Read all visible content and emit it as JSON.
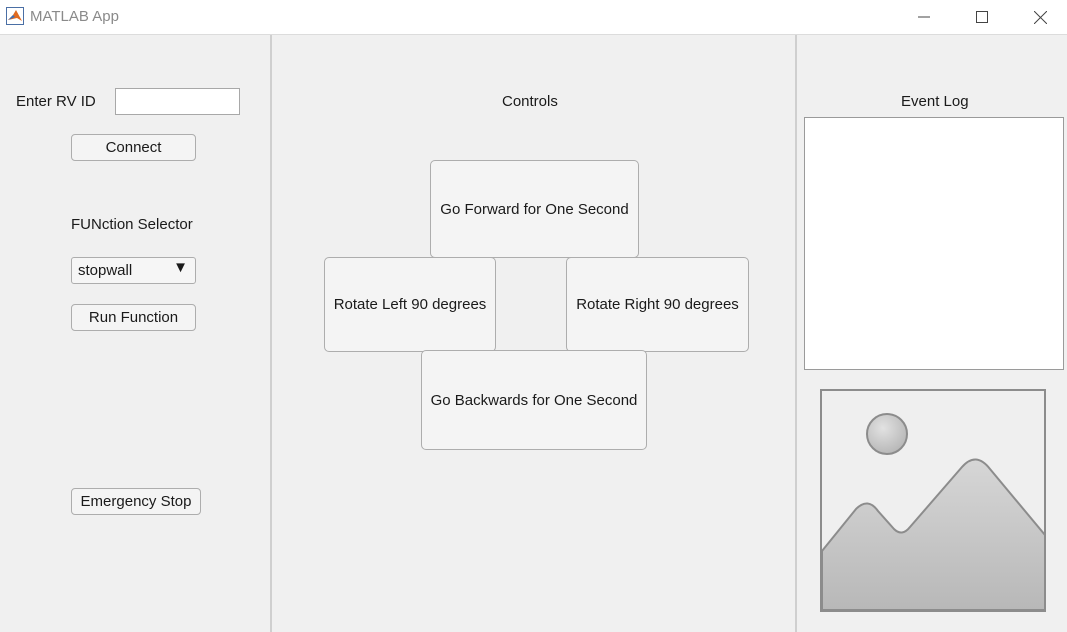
{
  "window": {
    "title": "MATLAB App",
    "icon": "matlab-icon",
    "controls": {
      "minimize": "minimize-icon",
      "maximize": "maximize-icon",
      "close": "close-icon"
    }
  },
  "left_panel": {
    "rv_id_label": "Enter RV ID",
    "rv_id_value": "",
    "connect_label": "Connect",
    "function_selector_label": "FUNction Selector",
    "function_selected": "stopwall",
    "run_function_label": "Run Function",
    "emergency_stop_label": "Emergency Stop"
  },
  "center_panel": {
    "title": "Controls",
    "forward_label": "Go Forward for One Second",
    "rotate_left_label": "Rotate Left 90 degrees",
    "rotate_right_label": "Rotate Right 90 degrees",
    "backward_label": "Go Backwards for One Second"
  },
  "right_panel": {
    "event_log_label": "Event Log",
    "event_log_content": "",
    "image_icon": "image-placeholder-icon"
  },
  "colors": {
    "background": "#f0f0f0",
    "button_bg": "#f4f4f4",
    "button_border": "#adadad",
    "title_text": "#8a8a8a"
  }
}
